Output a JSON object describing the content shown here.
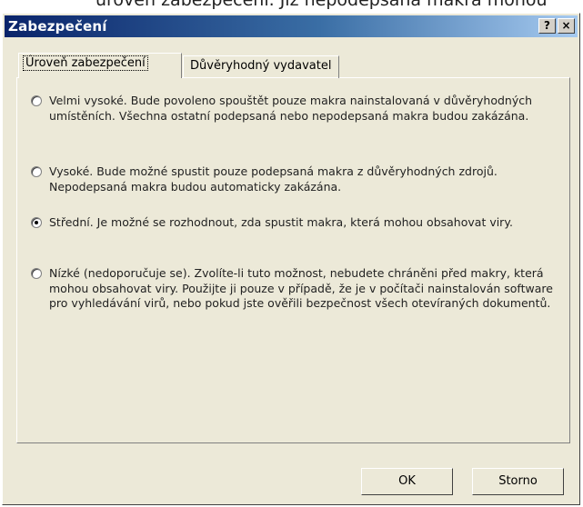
{
  "window": {
    "title": "Zabezpečení",
    "help_button": "?",
    "close_button": "×"
  },
  "tabs": [
    {
      "label": "Úroveň zabezpečení",
      "active": true
    },
    {
      "label": "Důvěryhodný vydavatel",
      "active": false
    }
  ],
  "options": [
    {
      "text": "Velmi vysoké. Bude povoleno spouštět pouze makra nainstalovaná v důvěryhodných umístěních. Všechna ostatní podepsaná nebo nepodepsaná makra budou zakázána.",
      "checked": false
    },
    {
      "text": "Vysoké. Bude možné spustit pouze podepsaná makra z důvěryhodných zdrojů. Nepodepsaná makra budou automaticky zakázána.",
      "checked": false
    },
    {
      "text": "Střední. Je možné se rozhodnout, zda spustit makra, která mohou obsahovat viry.",
      "checked": true
    },
    {
      "text": "Nízké (nedoporučuje se). Zvolíte-li tuto možnost, nebudete chráněni před makry, která mohou obsahovat viry. Použijte ji pouze v případě, že je v počítači nainstalován software pro vyhledávání virů, nebo pokud jste ověřili bezpečnost všech otevíraných dokumentů.",
      "checked": false
    }
  ],
  "buttons": {
    "ok": "OK",
    "cancel": "Storno"
  },
  "cropped_caption": "úroveň zabezpečení. Již nepodepsaná makra mohou"
}
